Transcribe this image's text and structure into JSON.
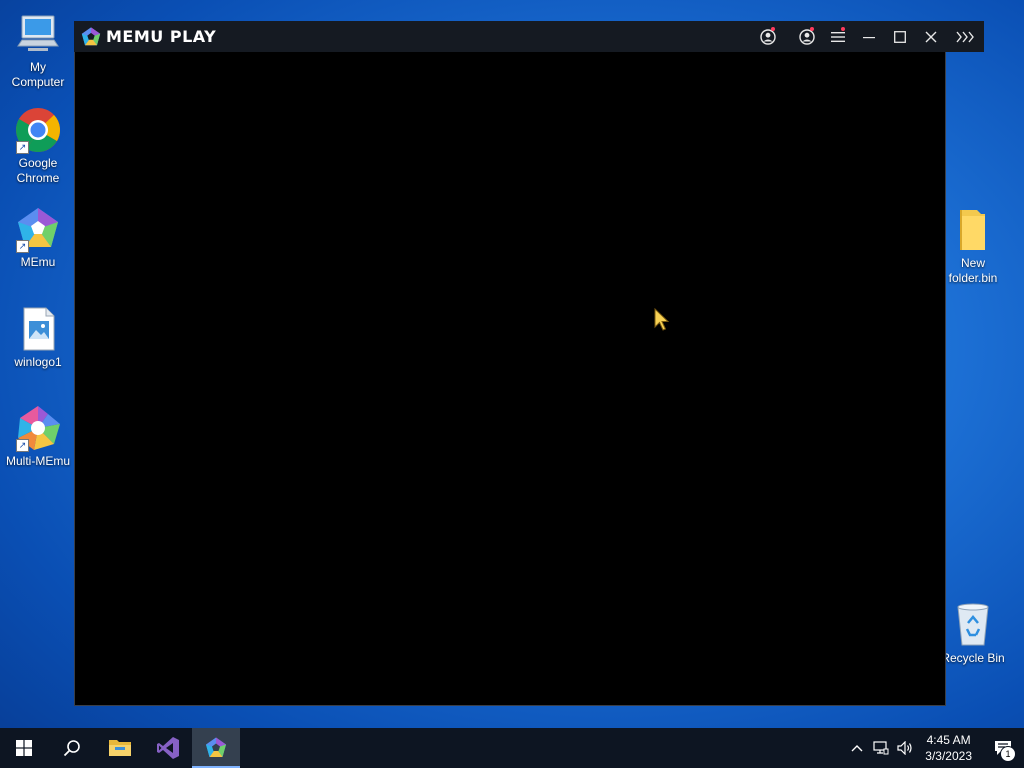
{
  "desktop": {
    "icons_left": [
      {
        "label": "My Computer",
        "icon": "computer-icon"
      },
      {
        "label": "Google Chrome",
        "icon": "chrome-icon",
        "shortcut": true
      },
      {
        "label": "MEmu",
        "icon": "memu-icon",
        "shortcut": true
      },
      {
        "label": "winlogo1",
        "icon": "image-file-icon"
      },
      {
        "label": "Multi-MEmu",
        "icon": "multi-memu-icon",
        "shortcut": true
      }
    ],
    "icons_right": [
      {
        "label": "New folder.bin",
        "icon": "folder-icon"
      },
      {
        "label": "Recycle Bin",
        "icon": "recycle-bin-icon"
      }
    ]
  },
  "memu_window": {
    "brand": "MEMU PLAY",
    "controls": [
      "account-icon",
      "user-icon",
      "menu-icon",
      "minimize-icon",
      "maximize-icon",
      "close-icon",
      "sidebar-expand-icon"
    ],
    "colors": {
      "titlebar": "#151a22",
      "body": "#000000",
      "notification_dot": "#ff3b5c"
    }
  },
  "taskbar": {
    "apps": [
      "start-icon",
      "search-icon",
      "file-explorer-icon",
      "visual-studio-icon",
      "memu-icon"
    ],
    "active_app": "memu-icon",
    "tray": [
      "chevron-up-icon",
      "network-icon",
      "volume-icon"
    ],
    "time": "4:45 AM",
    "date": "3/3/2023",
    "notification_count": "1"
  }
}
